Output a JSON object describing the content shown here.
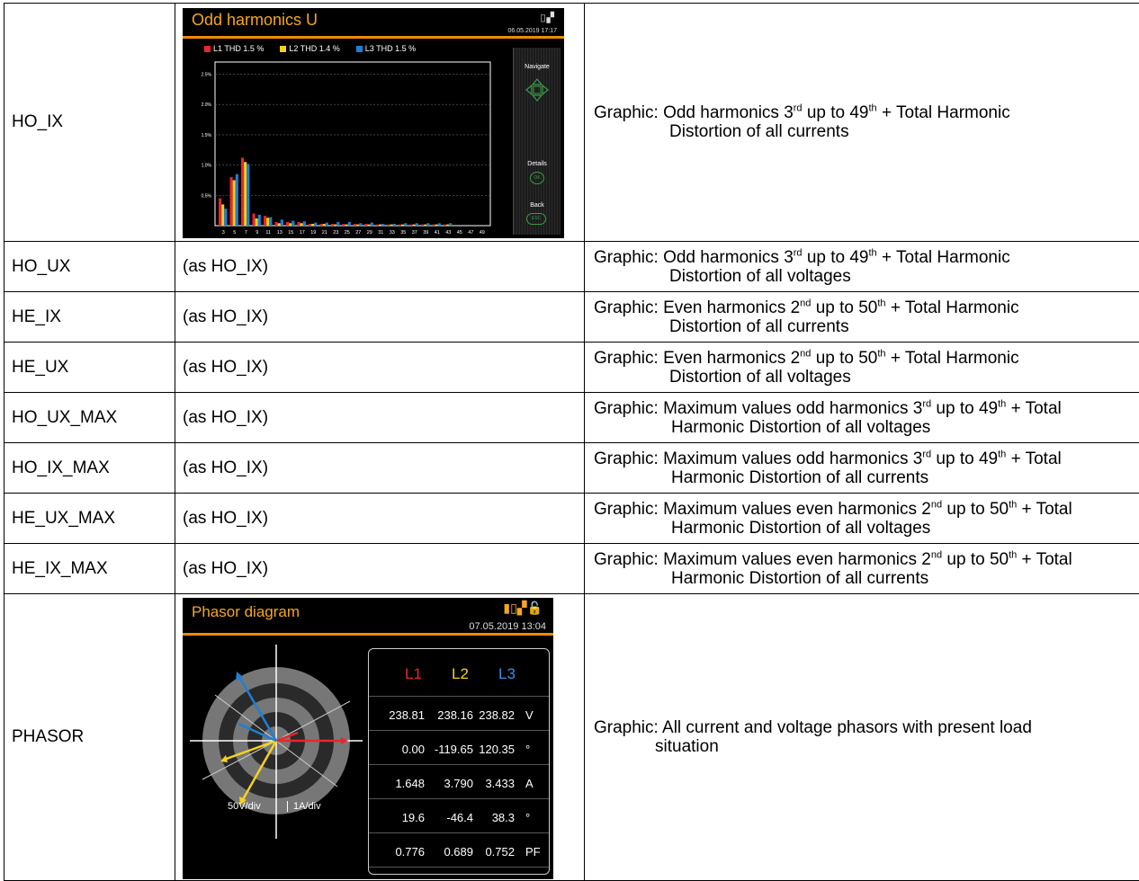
{
  "rows": [
    {
      "name": "HO_IX",
      "display": "",
      "desc_pre": "Graphic:  Odd harmonics 3",
      "sup1": "rd",
      "desc_mid": " up to 49",
      "sup2": "th",
      "desc_end": " + Total Harmonic",
      "desc_l2": "Distortion  of all currents"
    },
    {
      "name": "HO_UX",
      "display": "(as HO_IX)",
      "desc_pre": "Graphic: Odd harmonics 3",
      "sup1": "rd",
      "desc_mid": " up to 49",
      "sup2": "th",
      "desc_end": " + Total Harmonic",
      "desc_l2": "Distortion  of all voltages"
    },
    {
      "name": "HE_IX",
      "display": "(as HO_IX)",
      "desc_pre": "Graphic:  Even harmonics 2",
      "sup1": "nd",
      "desc_mid": " up to 50",
      "sup2": "th",
      "desc_end": " + Total Harmonic",
      "desc_l2": "Distortion  of all currents"
    },
    {
      "name": "HE_UX",
      "display": "(as HO_IX)",
      "desc_pre": "Graphic: Even harmonics 2",
      "sup1": "nd",
      "desc_mid": " up to 50",
      "sup2": "th",
      "desc_end": " + Total Harmonic",
      "desc_l2": "Distortion  of all voltages"
    },
    {
      "name": "HO_UX_MAX",
      "display": "(as HO_IX)",
      "desc_pre": "Graphic: Maximum values odd harmonics 3",
      "sup1": "rd",
      "desc_mid": " up to 49",
      "sup2": "th",
      "desc_end": " + Total",
      "desc_l2": "Harmonic Distortion  of all voltages"
    },
    {
      "name": "HO_IX_MAX",
      "display": "(as HO_IX)",
      "desc_pre": "Graphic:  Maximum values odd harmonics 3",
      "sup1": "rd",
      "desc_mid": " up to 49",
      "sup2": "th",
      "desc_end": " + Total",
      "desc_l2": "Harmonic Distortion  of all currents"
    },
    {
      "name": "HE_UX_MAX",
      "display": "(as HO_IX)",
      "desc_pre": "Graphic:  Maximum values even harmonics 2",
      "sup1": "nd",
      "desc_mid": " up to 50",
      "sup2": "th",
      "desc_end": " + Total",
      "desc_l2": "Harmonic Distortion  of all voltages"
    },
    {
      "name": "HE_IX_MAX",
      "display": "(as HO_IX)",
      "desc_pre": "Graphic:  Maximum values even harmonics 2",
      "sup1": "nd",
      "desc_mid": " up to 50",
      "sup2": "th",
      "desc_end": " + Total",
      "desc_l2": "Harmonic Distortion  of all currents"
    },
    {
      "name": "PHASOR",
      "display": "",
      "desc_pre": "Graphic: All current and voltage phasors with present load",
      "desc_l2": "situation"
    }
  ],
  "harmonics_screen": {
    "title": "Odd harmonics U",
    "date": "06.05.2019  17:17",
    "legend": [
      {
        "label": "L1  THD  1.5 %",
        "color": "#e8262b"
      },
      {
        "label": "L2  THD  1.4 %",
        "color": "#f7d21b"
      },
      {
        "label": "L3  THD  1.5 %",
        "color": "#1e7fd6"
      }
    ],
    "side": {
      "navigate": "Navigate",
      "details": "Details",
      "ok": "OK",
      "back": "Back",
      "esc": "ESC"
    }
  },
  "chart_data": {
    "type": "bar",
    "categories": [
      "3",
      "5",
      "7",
      "9",
      "11",
      "13",
      "15",
      "17",
      "19",
      "21",
      "23",
      "25",
      "27",
      "29",
      "31",
      "33",
      "35",
      "37",
      "39",
      "41",
      "43",
      "45",
      "47",
      "49"
    ],
    "series": [
      {
        "name": "L1",
        "color": "#e8262b",
        "values": [
          0.45,
          0.8,
          1.12,
          0.2,
          0.16,
          0.06,
          0.06,
          0.06,
          0.03,
          0.03,
          0.03,
          0.03,
          0.03,
          0.03,
          0.02,
          0.02,
          0.02,
          0.02,
          0.02,
          0.02,
          0.02,
          0,
          0,
          0
        ]
      },
      {
        "name": "L2",
        "color": "#f7d21b",
        "values": [
          0.35,
          0.75,
          1.05,
          0.12,
          0.13,
          0.04,
          0.04,
          0.04,
          0.03,
          0.03,
          0.02,
          0.02,
          0.02,
          0.02,
          0.02,
          0.02,
          0.02,
          0.02,
          0.02,
          0.02,
          0.02,
          0,
          0,
          0
        ]
      },
      {
        "name": "L3",
        "color": "#1e7fd6",
        "values": [
          0.28,
          0.85,
          1.02,
          0.18,
          0.14,
          0.1,
          0.08,
          0.07,
          0.05,
          0.05,
          0.06,
          0.06,
          0.04,
          0.05,
          0.03,
          0.03,
          0.04,
          0.04,
          0.04,
          0.04,
          0.04,
          0,
          0,
          0
        ]
      }
    ],
    "yticks": [
      "0.5%",
      "1.0%",
      "1.5%",
      "2.0%",
      "2.5%"
    ],
    "ylim": [
      0,
      2.7
    ],
    "grid": true
  },
  "phasor_screen": {
    "title": "Phasor diagram",
    "date": "07.05.2019   13:04",
    "headers": [
      {
        "t": "L1",
        "c": "#e8262b"
      },
      {
        "t": "L2",
        "c": "#f7d21b"
      },
      {
        "t": "L3",
        "c": "#3a8fe6"
      }
    ],
    "table": [
      [
        "238.81",
        "238.16",
        "238.82",
        "V"
      ],
      [
        "0.00",
        "-119.65",
        "120.35",
        "°"
      ],
      [
        "1.648",
        "3.790",
        "3.433",
        "A"
      ],
      [
        "19.6",
        "-46.4",
        "38.3",
        "°"
      ],
      [
        "0.776",
        "0.689",
        "0.752",
        "PF"
      ]
    ],
    "scale_v": "50V/div",
    "scale_i": "1A/div"
  }
}
